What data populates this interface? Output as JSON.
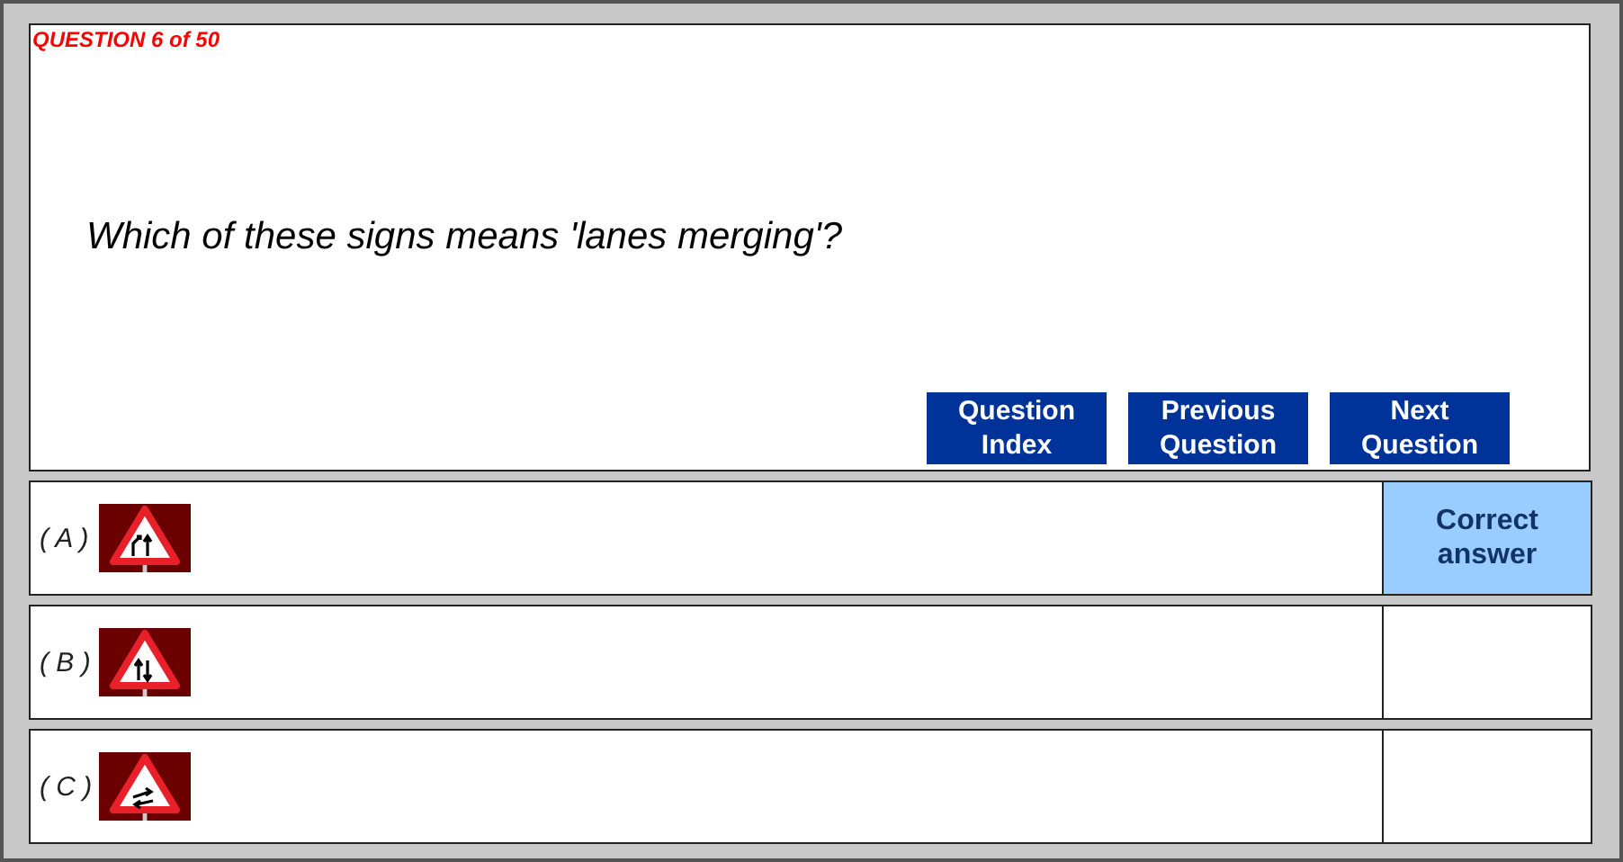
{
  "progress": "QUESTION 6 of 50",
  "question": "Which of these signs means 'lanes merging'?",
  "buttons": [
    {
      "label": "Question Index"
    },
    {
      "label": "Previous Question"
    },
    {
      "label": "Next Question"
    }
  ],
  "answers": [
    {
      "label": "( A )",
      "kind": "merge",
      "revealed": true,
      "feedback": "Correct answer"
    },
    {
      "label": "( B )",
      "kind": "twoway",
      "revealed": false
    },
    {
      "label": "( C )",
      "kind": "swap",
      "revealed": false
    }
  ]
}
